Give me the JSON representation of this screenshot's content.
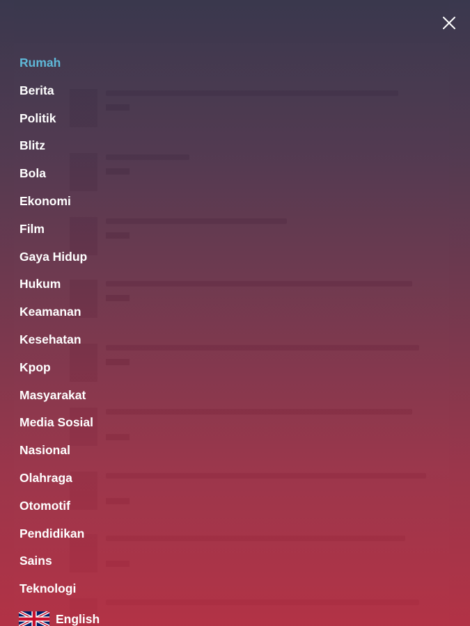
{
  "drawer": {
    "close_icon": "close-icon",
    "menu_items": [
      {
        "label": "Rumah",
        "active": true
      },
      {
        "label": "Berita"
      },
      {
        "label": "Politik"
      },
      {
        "label": "Blitz"
      },
      {
        "label": "Bola"
      },
      {
        "label": "Ekonomi"
      },
      {
        "label": "Film"
      },
      {
        "label": "Gaya Hidup"
      },
      {
        "label": "Hukum"
      },
      {
        "label": "Keamanan"
      },
      {
        "label": "Kesehatan"
      },
      {
        "label": "Kpop"
      },
      {
        "label": "Masyarakat"
      },
      {
        "label": "Media Sosial"
      },
      {
        "label": "Nasional"
      },
      {
        "label": "Olahraga"
      },
      {
        "label": "Otomotif"
      },
      {
        "label": "Pendidikan"
      },
      {
        "label": "Sains"
      },
      {
        "label": "Teknologi"
      }
    ],
    "language": {
      "flag_icon": "uk-flag-icon",
      "label": "English"
    },
    "colors": {
      "active": "#5fb8d8",
      "text": "#ffffff",
      "gradient_top": "#343248",
      "gradient_bottom": "#b02c40"
    }
  }
}
